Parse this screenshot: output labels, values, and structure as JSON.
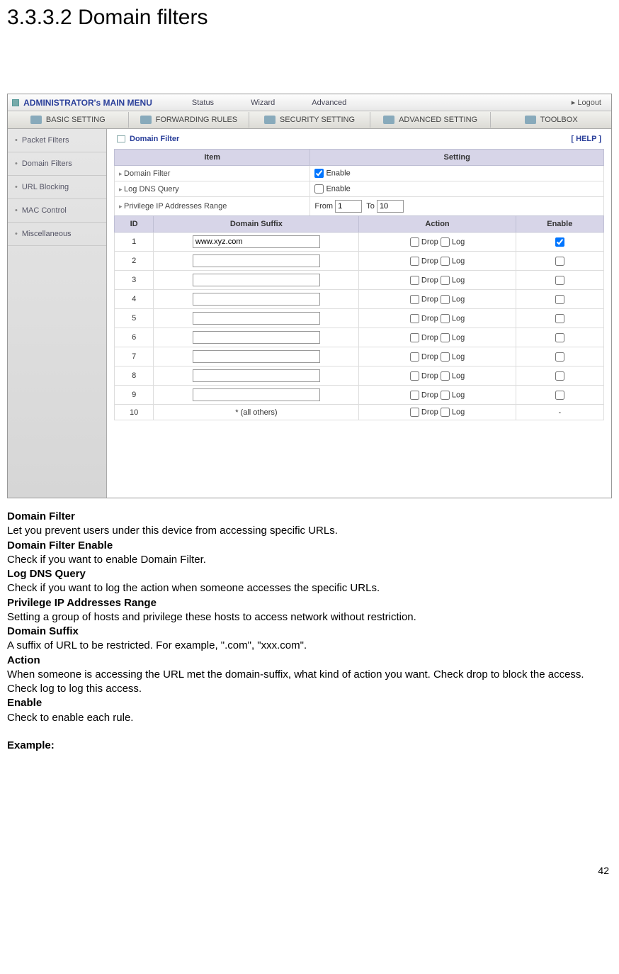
{
  "heading": "3.3.3.2 Domain filters",
  "topbar": {
    "title": "ADMINISTRATOR's MAIN MENU",
    "items": [
      "Status",
      "Wizard",
      "Advanced"
    ],
    "logout": "Logout"
  },
  "tabs": [
    "BASIC SETTING",
    "FORWARDING RULES",
    "SECURITY SETTING",
    "ADVANCED SETTING",
    "TOOLBOX"
  ],
  "sidebar": [
    "Packet Filters",
    "Domain Filters",
    "URL Blocking",
    "MAC Control",
    "Miscellaneous"
  ],
  "panel": {
    "title": "Domain Filter",
    "help": "[ HELP ]"
  },
  "cols": {
    "item": "Item",
    "setting": "Setting"
  },
  "settings": {
    "domain_filter_label": "Domain Filter",
    "log_dns_label": "Log DNS Query",
    "priv_label": "Privilege IP Addresses Range",
    "enable_label": "Enable",
    "from_label": "From",
    "to_label": "To",
    "from_val": "1",
    "to_val": "10",
    "domain_filter_checked": true,
    "log_dns_checked": false
  },
  "rulecols": {
    "id": "ID",
    "suffix": "Domain Suffix",
    "action": "Action",
    "enable": "Enable"
  },
  "action_labels": {
    "drop": "Drop",
    "log": "Log"
  },
  "rules": [
    {
      "id": "1",
      "suffix": "www.xyz.com",
      "drop": false,
      "log": false,
      "enable": true,
      "enable_show": true
    },
    {
      "id": "2",
      "suffix": "",
      "drop": false,
      "log": false,
      "enable": false,
      "enable_show": true
    },
    {
      "id": "3",
      "suffix": "",
      "drop": false,
      "log": false,
      "enable": false,
      "enable_show": true
    },
    {
      "id": "4",
      "suffix": "",
      "drop": false,
      "log": false,
      "enable": false,
      "enable_show": true
    },
    {
      "id": "5",
      "suffix": "",
      "drop": false,
      "log": false,
      "enable": false,
      "enable_show": true
    },
    {
      "id": "6",
      "suffix": "",
      "drop": false,
      "log": false,
      "enable": false,
      "enable_show": true
    },
    {
      "id": "7",
      "suffix": "",
      "drop": false,
      "log": false,
      "enable": false,
      "enable_show": true
    },
    {
      "id": "8",
      "suffix": "",
      "drop": false,
      "log": false,
      "enable": false,
      "enable_show": true
    },
    {
      "id": "9",
      "suffix": "",
      "drop": false,
      "log": false,
      "enable": false,
      "enable_show": true
    },
    {
      "id": "10",
      "suffix": "* (all others)",
      "drop": false,
      "log": false,
      "enable": false,
      "enable_show": false,
      "readonly": true
    }
  ],
  "doc": [
    {
      "term": "Domain Filter",
      "text": "Let you prevent users under this device from accessing specific URLs."
    },
    {
      "term": "Domain Filter Enable",
      "text": "Check if you want to enable Domain Filter."
    },
    {
      "term": "Log DNS Query",
      "text": "Check if you want to log the action when someone accesses the specific URLs."
    },
    {
      "term": "Privilege IP Addresses Range",
      "text": "Setting a group of hosts and privilege these hosts to access network without restriction."
    },
    {
      "term": "Domain Suffix",
      "text": "A suffix of URL to be restricted. For example, \".com\", \"xxx.com\"."
    },
    {
      "term": "Action",
      "text": "When someone is accessing the URL met the domain-suffix, what kind of action you want. Check drop to block the access. Check log to log this access."
    },
    {
      "term": "Enable",
      "text": "Check to enable each rule."
    }
  ],
  "example_label": "Example:",
  "page_number": "42"
}
